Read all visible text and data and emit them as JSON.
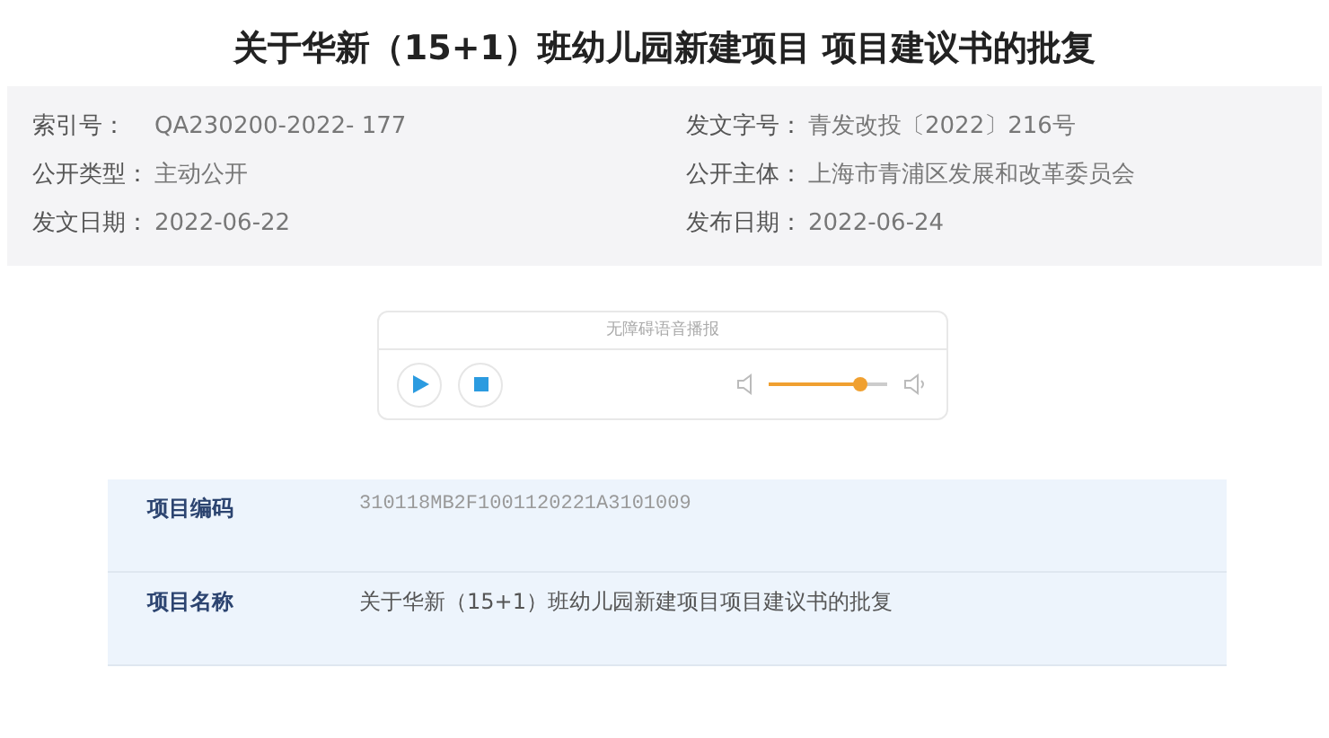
{
  "title": "关于华新（15+1）班幼儿园新建项目 项目建议书的批复",
  "meta": [
    {
      "label": "索引号：",
      "value": "QA230200-2022- 177"
    },
    {
      "label": "发文字号：",
      "value": "青发改投〔2022〕216号"
    },
    {
      "label": "公开类型：",
      "value": "主动公开"
    },
    {
      "label": "公开主体：",
      "value": "上海市青浦区发展和改革委员会"
    },
    {
      "label": "发文日期：",
      "value": "2022-06-22"
    },
    {
      "label": "发布日期：",
      "value": "2022-06-24"
    }
  ],
  "player": {
    "header": "无障碍语音播报"
  },
  "table": [
    {
      "label": "项目编码",
      "value": "310118MB2F1001120221A3101009",
      "kind": "code"
    },
    {
      "label": "项目名称",
      "value": "关于华新（15+1）班幼儿园新建项目项目建议书的批复",
      "kind": "text"
    }
  ]
}
